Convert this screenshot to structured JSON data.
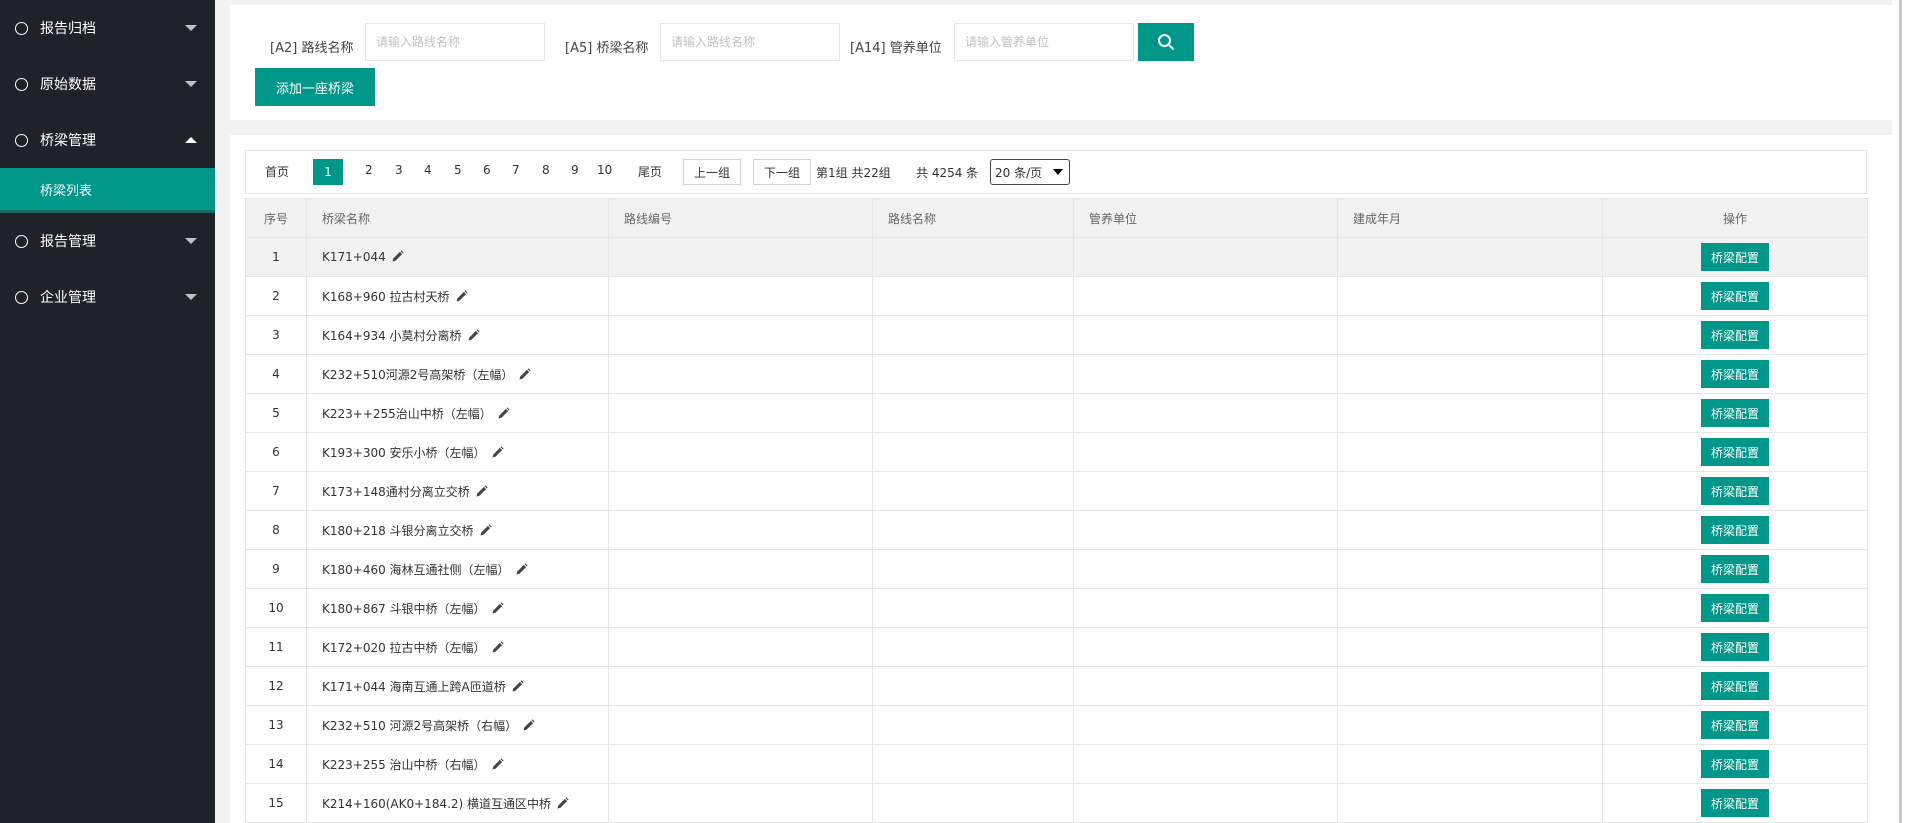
{
  "sidebar": {
    "items": [
      {
        "label": "报告归档"
      },
      {
        "label": "原始数据"
      },
      {
        "label": "桥梁管理",
        "sub": "桥梁列表"
      },
      {
        "label": "报告管理"
      },
      {
        "label": "企业管理"
      }
    ]
  },
  "search": {
    "route_label": "[A2] 路线名称",
    "route_placeholder": "请输入路线名称",
    "bridge_label": "[A5] 桥梁名称",
    "bridge_placeholder": "请输入路线名称",
    "unit_label": "[A14] 管养单位",
    "unit_placeholder": "请输入管养单位",
    "add_label": "添加一座桥梁"
  },
  "pager": {
    "first": "首页",
    "pages": [
      "1",
      "2",
      "3",
      "4",
      "5",
      "6",
      "7",
      "8",
      "9",
      "10"
    ],
    "last": "尾页",
    "prev_group": "上一组",
    "next_group": "下一组",
    "group_info": "第1组 共22组",
    "total": "共 4254 条",
    "page_size": "20 条/页"
  },
  "table": {
    "headers": [
      "序号",
      "桥梁名称",
      "路线编号",
      "路线名称",
      "管养单位",
      "建成年月",
      "操作"
    ],
    "action_label": "桥梁配置",
    "rows": [
      {
        "idx": "1",
        "name": "K171+044"
      },
      {
        "idx": "2",
        "name": "K168+960 拉古村天桥"
      },
      {
        "idx": "3",
        "name": "K164+934 小莫村分离桥"
      },
      {
        "idx": "4",
        "name": "K232+510河源2号高架桥（左幅）"
      },
      {
        "idx": "5",
        "name": "K223++255治山中桥（左幅）"
      },
      {
        "idx": "6",
        "name": "K193+300 安乐小桥（左幅）"
      },
      {
        "idx": "7",
        "name": "K173+148通村分离立交桥"
      },
      {
        "idx": "8",
        "name": "K180+218 斗银分离立交桥"
      },
      {
        "idx": "9",
        "name": "K180+460 海林互通社侧（左幅）"
      },
      {
        "idx": "10",
        "name": "K180+867 斗银中桥（左幅）"
      },
      {
        "idx": "11",
        "name": "K172+020 拉古中桥（左幅）"
      },
      {
        "idx": "12",
        "name": "K171+044 海南互通上跨A匝道桥"
      },
      {
        "idx": "13",
        "name": "K232+510 河源2号高架桥（右幅）"
      },
      {
        "idx": "14",
        "name": "K223+255 治山中桥（右幅）"
      },
      {
        "idx": "15",
        "name": "K214+160(AK0+184.2) 横道互通区中桥"
      }
    ]
  }
}
